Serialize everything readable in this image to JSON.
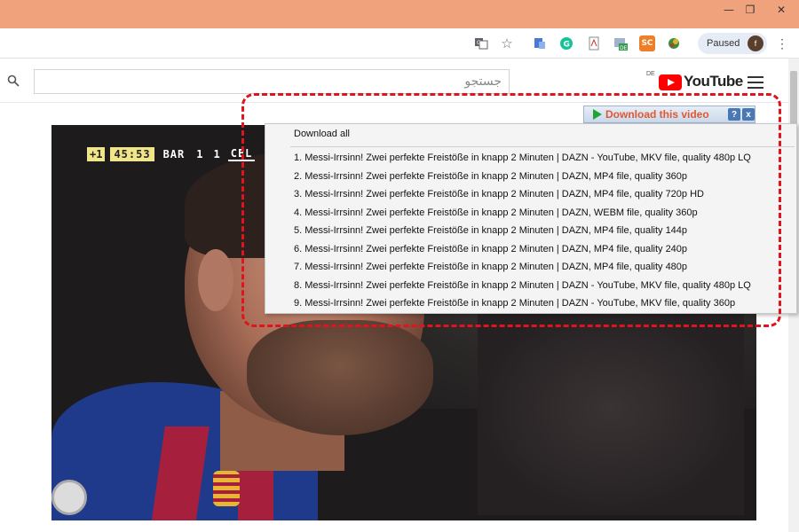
{
  "window": {
    "controls": {
      "minimize": "—",
      "maximize": "❐",
      "close": "✕"
    }
  },
  "toolbar": {
    "icons": [
      "translate-icon",
      "star-icon",
      "docs-icon",
      "grammarly-icon",
      "pdf-icon",
      "de-extension-icon",
      "sc-extension-icon",
      "globe-extension-icon"
    ],
    "profile_label": "Paused",
    "profile_initial": "f"
  },
  "youtube": {
    "search_placeholder": "جستجو",
    "logo_region": "DE",
    "logo_text": "YouTube"
  },
  "video": {
    "scoreboard": {
      "indicator": "+1",
      "time": "45:53",
      "home_team": "BAR",
      "home_score": "1",
      "away_score": "1",
      "away_team": "CEL"
    }
  },
  "downloader": {
    "button_label": "Download this video",
    "help_label": "?",
    "close_label": "x",
    "download_all_label": "Download all",
    "items": [
      "1.  Messi-Irrsinn! Zwei perfekte Freistöße in knapp 2 Minuten | DAZN - YouTube,  MKV file, quality 480p LQ",
      "2.  Messi-Irrsinn! Zwei perfekte Freistöße in knapp 2 Minuten | DAZN,  MP4 file, quality 360p",
      "3.  Messi-Irrsinn! Zwei perfekte Freistöße in knapp 2 Minuten | DAZN,  MP4 file, quality 720p HD",
      "4.  Messi-Irrsinn! Zwei perfekte Freistöße in knapp 2 Minuten | DAZN,  WEBM file, quality 360p",
      "5.  Messi-Irrsinn! Zwei perfekte Freistöße in knapp 2 Minuten | DAZN,  MP4 file, quality 144p",
      "6.  Messi-Irrsinn! Zwei perfekte Freistöße in knapp 2 Minuten | DAZN,  MP4 file, quality 240p",
      "7.  Messi-Irrsinn! Zwei perfekte Freistöße in knapp 2 Minuten | DAZN,  MP4 file, quality 480p",
      "8.  Messi-Irrsinn! Zwei perfekte Freistöße in knapp 2 Minuten | DAZN - YouTube,  MKV file, quality 480p LQ",
      "9.  Messi-Irrsinn! Zwei perfekte Freistöße in knapp 2 Minuten | DAZN - YouTube,  MKV file, quality 360p"
    ]
  },
  "colors": {
    "titlebar": "#f0a27d",
    "highlight": "#e0141e",
    "download_text": "#e4572e",
    "download_arrow": "#23a23a",
    "youtube_red": "#ff0000"
  }
}
